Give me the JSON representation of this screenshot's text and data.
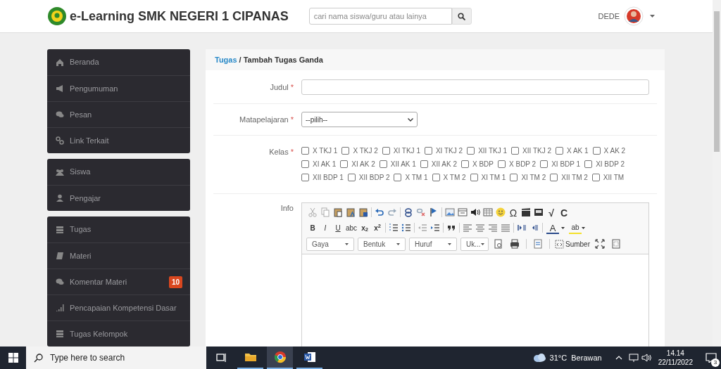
{
  "header": {
    "title": "e-Learning SMK NEGERI 1 CIPANAS",
    "search": {
      "placeholder": "cari nama siswa/guru atau lainya"
    },
    "user": "DEDE"
  },
  "sidebar": {
    "groups": [
      {
        "items": [
          {
            "label": "Beranda"
          },
          {
            "label": "Pengumuman"
          },
          {
            "label": "Pesan"
          },
          {
            "label": "Link Terkait"
          }
        ]
      },
      {
        "items": [
          {
            "label": "Siswa"
          },
          {
            "label": "Pengajar"
          }
        ]
      },
      {
        "items": [
          {
            "label": "Tugas"
          },
          {
            "label": "Materi"
          },
          {
            "label": "Komentar Materi",
            "badge": "10"
          },
          {
            "label": "Pencapaian Kompetensi Dasar"
          },
          {
            "label": "Tugas Kelompok"
          }
        ]
      }
    ]
  },
  "breadcrumb": {
    "link": "Tugas",
    "separator": "/",
    "current": "Tambah Tugas Ganda"
  },
  "form": {
    "judul": {
      "label": "Judul",
      "mark": "*"
    },
    "matapelajaran": {
      "label": "Matapelajaran",
      "mark": "*",
      "value": "--pilih--"
    },
    "kelas": {
      "label": "Kelas",
      "mark": "*",
      "options": [
        {
          "label": "X TKJ 1",
          "checked": false
        },
        {
          "label": "X TKJ 2",
          "checked": false
        },
        {
          "label": "XI TKJ 1",
          "checked": false
        },
        {
          "label": "XI TKJ 2",
          "checked": false
        },
        {
          "label": "XII TKJ 1",
          "checked": false
        },
        {
          "label": "XII TKJ 2",
          "checked": false
        },
        {
          "label": "X AK 1",
          "checked": false
        },
        {
          "label": "X AK 2",
          "checked": false
        },
        {
          "label": "XI AK 1",
          "checked": false
        },
        {
          "label": "XI AK 2",
          "checked": false
        },
        {
          "label": "XII AK 1",
          "checked": false
        },
        {
          "label": "XII AK 2",
          "checked": false
        },
        {
          "label": "X BDP",
          "checked": false
        },
        {
          "label": "X BDP 2",
          "checked": false
        },
        {
          "label": "XI BDP 1",
          "checked": false
        },
        {
          "label": "XI BDP 2",
          "checked": false
        },
        {
          "label": "XII BDP 1",
          "checked": false
        },
        {
          "label": "XII BDP 2",
          "checked": false
        },
        {
          "label": "X TM 1",
          "checked": false
        },
        {
          "label": "X TM 2",
          "checked": false
        },
        {
          "label": "XI TM 1",
          "checked": false
        },
        {
          "label": "XI TM 2",
          "checked": false
        },
        {
          "label": "XII TM 2",
          "checked": false
        },
        {
          "label": "XII TM",
          "checked": false
        }
      ]
    },
    "info": {
      "label": "Info",
      "editor": {
        "glyphs": [
          "Ω",
          "√",
          "C",
          "B",
          "I",
          "U",
          "abc",
          "x$_{2}$",
          "x$^{2}$",
          "A",
          "ab"
        ],
        "dropdowns": [
          "Gaya",
          "Bentuk",
          "Huruf",
          "Uk..."
        ],
        "source": "Sumber"
      }
    }
  },
  "taskbar": {
    "search": {
      "placeholder": "Type here to search"
    },
    "weather": "31°C  Berawan",
    "time": "14.14",
    "date": "22/11/2022",
    "notifications": "3"
  }
}
